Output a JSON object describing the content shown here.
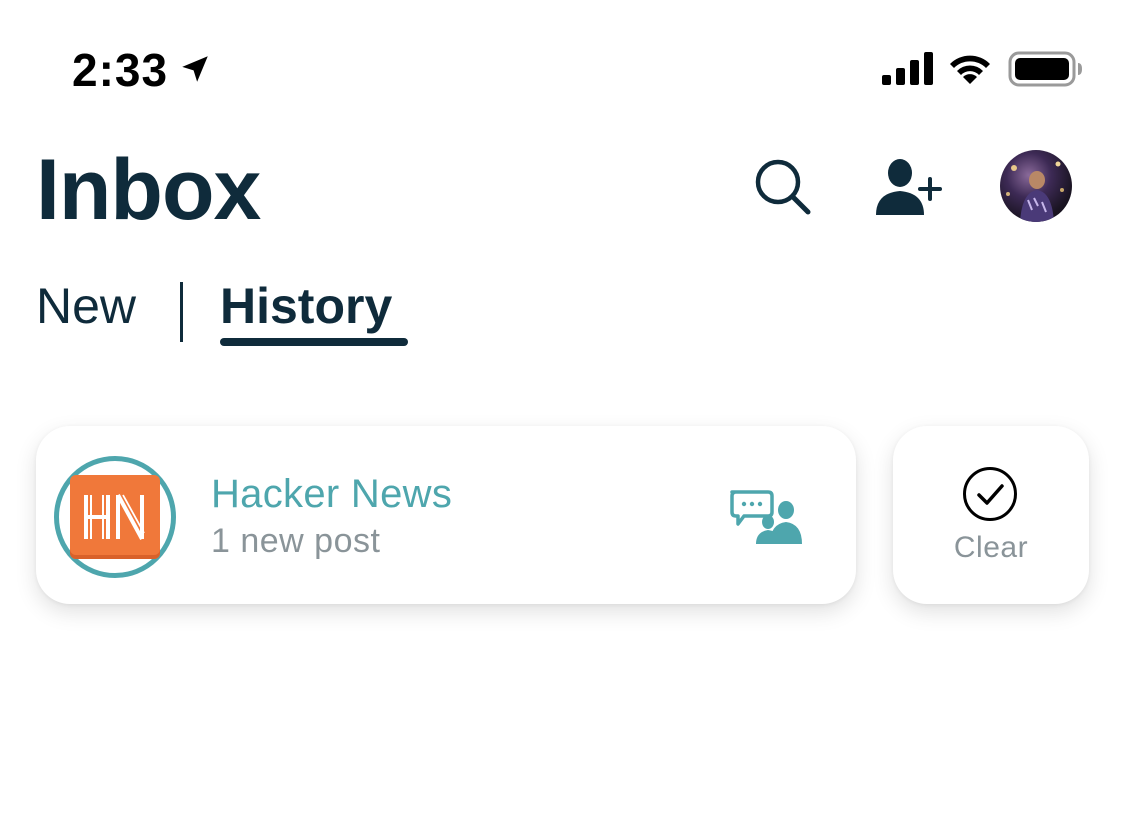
{
  "status_bar": {
    "time": "2:33",
    "icons": [
      "location-arrow-icon",
      "cellular-signal-icon",
      "wifi-icon",
      "battery-icon"
    ]
  },
  "header": {
    "title": "Inbox",
    "actions": [
      "search-icon",
      "add-user-icon",
      "profile-avatar"
    ]
  },
  "tabs": {
    "new_label": "New",
    "history_label": "History",
    "active": "History"
  },
  "feed": {
    "items": [
      {
        "logo_text": "HN",
        "name": "Hacker News",
        "subtitle": "1 new post",
        "icon": "discussion-group-icon"
      }
    ],
    "clear_label": "Clear"
  },
  "colors": {
    "primary_text": "#0f2b3b",
    "accent_teal": "#4ea6ad",
    "muted_text": "#8a9499",
    "hn_orange": "#f0783a"
  }
}
